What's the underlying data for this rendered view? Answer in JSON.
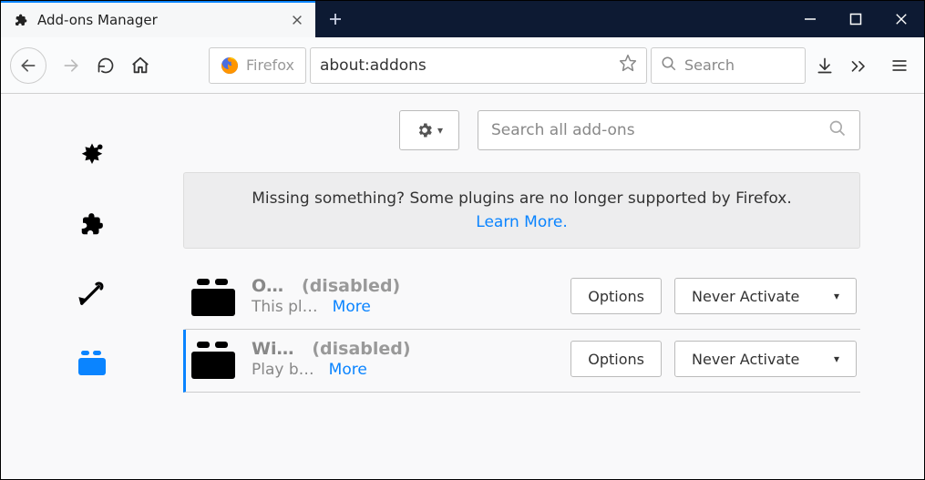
{
  "window": {
    "tab_label": "Add-ons Manager"
  },
  "navbar": {
    "identity": "Firefox",
    "url": "about:addons",
    "search_placeholder": "Search"
  },
  "main": {
    "search_placeholder": "Search all add-ons",
    "banner_text": "Missing something? Some plugins are no longer supported by Firefox.",
    "banner_link": "Learn More."
  },
  "addons": [
    {
      "name": "O…",
      "status": "(disabled)",
      "desc": "This pl…",
      "more": "More",
      "options": "Options",
      "activate": "Never Activate",
      "selected": false
    },
    {
      "name": "Wi…",
      "status": "(disabled)",
      "desc": "Play b…",
      "more": "More",
      "options": "Options",
      "activate": "Never Activate",
      "selected": true
    }
  ]
}
